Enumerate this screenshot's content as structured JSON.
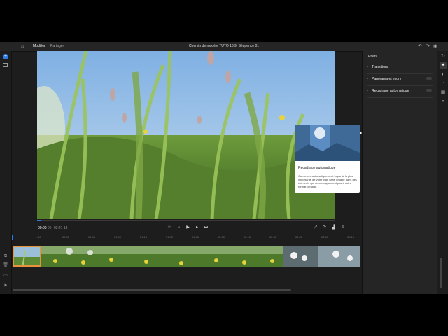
{
  "topbar": {
    "tabs": [
      {
        "label": "Modifier",
        "active": true
      },
      {
        "label": "Partager",
        "active": false
      }
    ],
    "title": "Chemin de modèle TUTO 16:9: Séquence  01",
    "icons": [
      "undo-icon",
      "redo-icon",
      "help-icon"
    ]
  },
  "transport": {
    "timecode_main": "00:00",
    "timecode_frames": "00",
    "duration": "03:41",
    "duration_frames": "13"
  },
  "ruler": {
    "ticks": [
      "::15",
      "00:30",
      "00:45",
      "01:00",
      "01:15",
      "01:30",
      "01:45",
      "02:00",
      "02:15",
      "02:30",
      "02:45",
      "03:00",
      "03:15"
    ]
  },
  "effects": {
    "title": "Effets",
    "items": [
      {
        "label": "Transitions",
        "toggle": false
      },
      {
        "label": "Panorama et zoom",
        "toggle": true
      },
      {
        "label": "Recadrage automatique",
        "toggle": true
      }
    ]
  },
  "tooltip": {
    "title": "Recadrage automatique",
    "body": "Conserver automatiquement la partie la plus importante de votre plan dans l'image dans des éléments qui ne correspondent pas à votre format d'image."
  },
  "colors": {
    "accent": "#2d7be5",
    "clip_selected": "#e8923d",
    "panel": "#252525",
    "background": "#1d1d1d"
  }
}
